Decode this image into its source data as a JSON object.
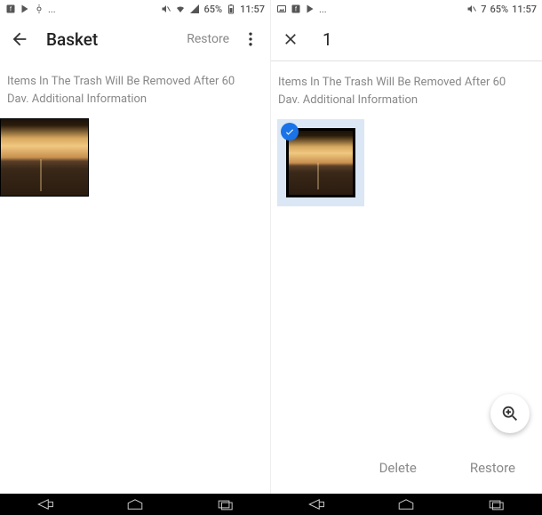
{
  "left": {
    "status": {
      "battery": "65%",
      "time": "11:57"
    },
    "appbar": {
      "title": "Basket",
      "restore": "Restore"
    },
    "info_line1": "Items In The Trash Will Be Removed After 60",
    "info_line2": "Dav. Additional Information"
  },
  "right": {
    "status": {
      "battery": "65%",
      "time": "11:57",
      "extra": "7"
    },
    "appbar": {
      "count": "1"
    },
    "info_line1": "Items In The Trash Will Be Removed After 60",
    "info_line2": "Dav. Additional Information",
    "actions": {
      "delete": "Delete",
      "restore": "Restore"
    }
  },
  "icons": {
    "back": "back-arrow-icon",
    "more": "more-vert-icon",
    "close": "close-icon",
    "check": "check-icon",
    "zoom": "zoom-in-icon",
    "nav_back": "nav-back-icon",
    "nav_home": "nav-home-icon",
    "nav_recent": "nav-recent-icon"
  }
}
